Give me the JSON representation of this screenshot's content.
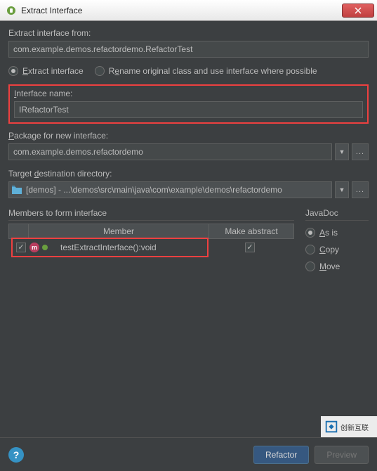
{
  "window": {
    "title": "Extract Interface"
  },
  "form": {
    "extractFromLabel": "Extract interface from:",
    "extractFromValue": "com.example.demos.refactordemo.RefactorTest",
    "modeExtract": "Extract interface",
    "modeRename": "Rename original class and use interface where possible",
    "interfaceNameLabel": "Interface name:",
    "interfaceNameValue": "IRefactorTest",
    "packageLabel": "Package for new interface:",
    "packageValue": "com.example.demos.refactordemo",
    "targetDirLabel": "Target destination directory:",
    "targetDirValue": "[demos] - ...\\demos\\src\\main\\java\\com\\example\\demos\\refactordemo",
    "membersLabel": "Members to form interface",
    "columns": {
      "member": "Member",
      "abstract": "Make abstract"
    },
    "rows": [
      {
        "name": "testExtractInterface():void",
        "checked": true,
        "abstract": true
      }
    ],
    "javadoc": {
      "title": "JavaDoc",
      "asIs": "As is",
      "copy": "Copy",
      "move": "Move"
    }
  },
  "buttons": {
    "refactor": "Refactor",
    "preview": "Preview"
  },
  "watermark": "创新互联"
}
